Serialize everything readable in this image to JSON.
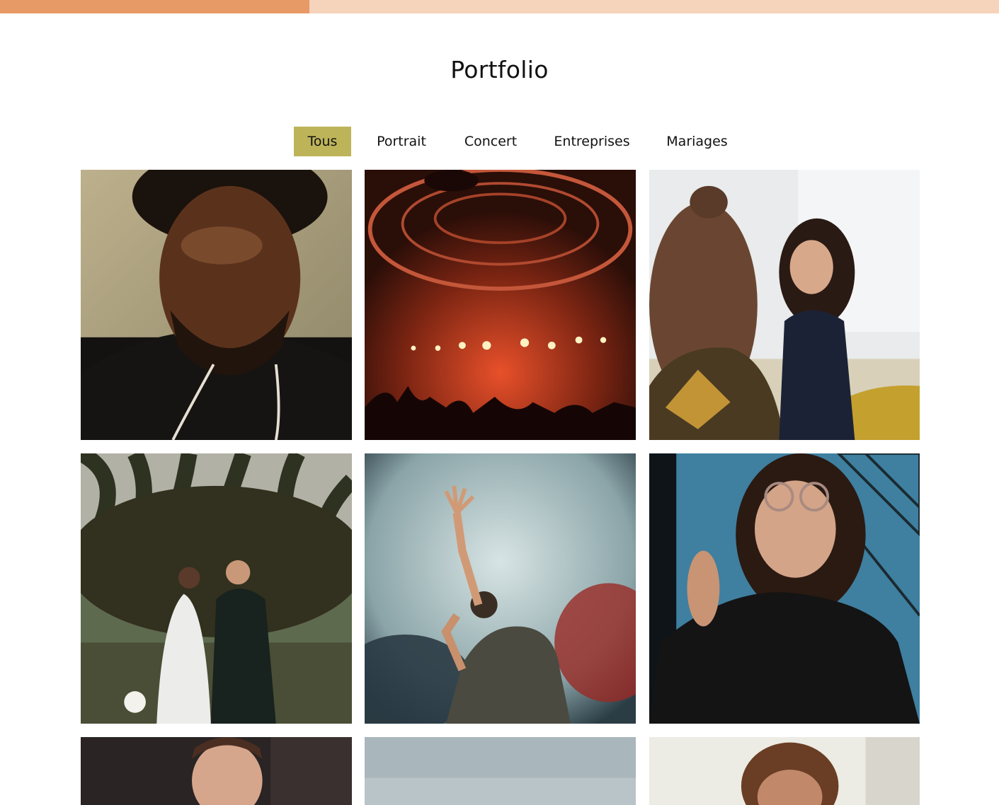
{
  "scroll_progress": 0.31,
  "title": "Portfolio",
  "filters": [
    {
      "label": "Tous",
      "active": true
    },
    {
      "label": "Portrait",
      "active": false
    },
    {
      "label": "Concert",
      "active": false
    },
    {
      "label": "Entreprises",
      "active": false
    },
    {
      "label": "Mariages",
      "active": false
    }
  ],
  "colors": {
    "progress_fill": "#e89a66",
    "progress_track": "#f6d3bb",
    "active_filter": "#bdb459"
  },
  "gallery": [
    {
      "subject": "portrait-man-closed-eyes"
    },
    {
      "subject": "concert-stage-red-lights"
    },
    {
      "subject": "business-meeting-smiling-woman"
    },
    {
      "subject": "wedding-couple-palm-tree"
    },
    {
      "subject": "concert-singer-smoke"
    },
    {
      "subject": "portrait-woman-glasses"
    },
    {
      "subject": "portrait-man-dark-background"
    },
    {
      "subject": "outdoor-sky"
    },
    {
      "subject": "portrait-smiling-woman"
    }
  ]
}
